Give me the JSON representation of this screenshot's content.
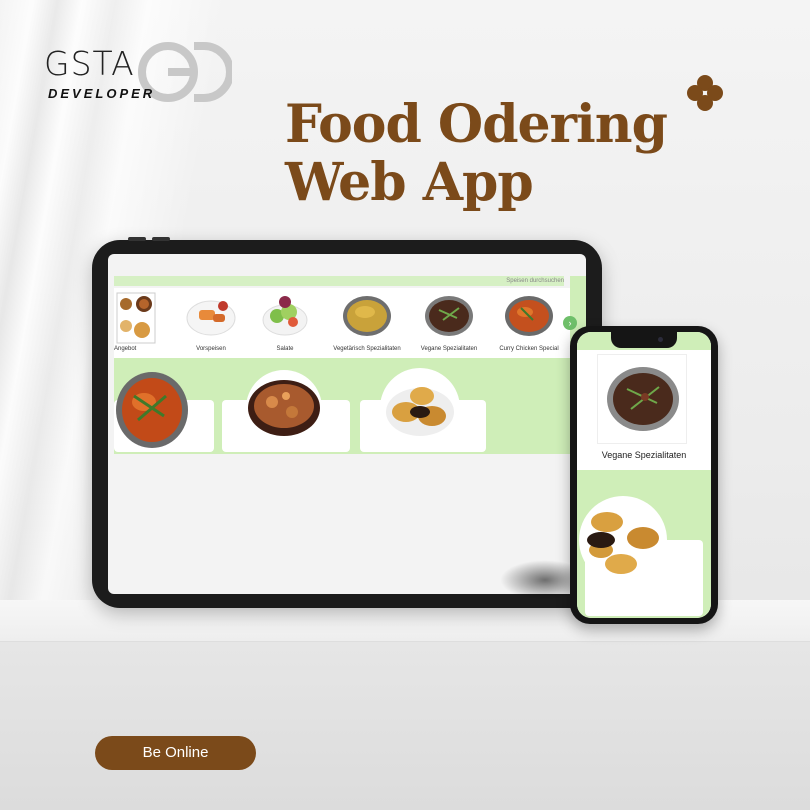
{
  "brand": {
    "logo_text": "GSTA",
    "logo_subtext": "DEVELOPER",
    "logo_mark_letters": "GD"
  },
  "headline": {
    "line1": "Food Odering",
    "line2": "Web App"
  },
  "tablet": {
    "search_label": "Speisen durchsuchen",
    "categories": [
      {
        "label": "Angebot",
        "icon": "platter-icon"
      },
      {
        "label": "Vorspeisen",
        "icon": "plate-icon"
      },
      {
        "label": "Salate",
        "icon": "salad-icon"
      },
      {
        "label": "Vegetärisch Spezialitaten",
        "icon": "curry-bowl-icon"
      },
      {
        "label": "Vegane Spezialitaten",
        "icon": "curry-bowl-icon"
      },
      {
        "label": "Curry Chicken Special",
        "icon": "curry-bowl-icon"
      }
    ],
    "next_icon": "chevron-right-icon"
  },
  "phone": {
    "caption": "Vegane Spezialitaten"
  },
  "cta": {
    "label": "Be Online"
  },
  "colors": {
    "accent": "#7b4a1a",
    "app_green": "#cfeeb8",
    "button_green": "#6fbf6a"
  }
}
